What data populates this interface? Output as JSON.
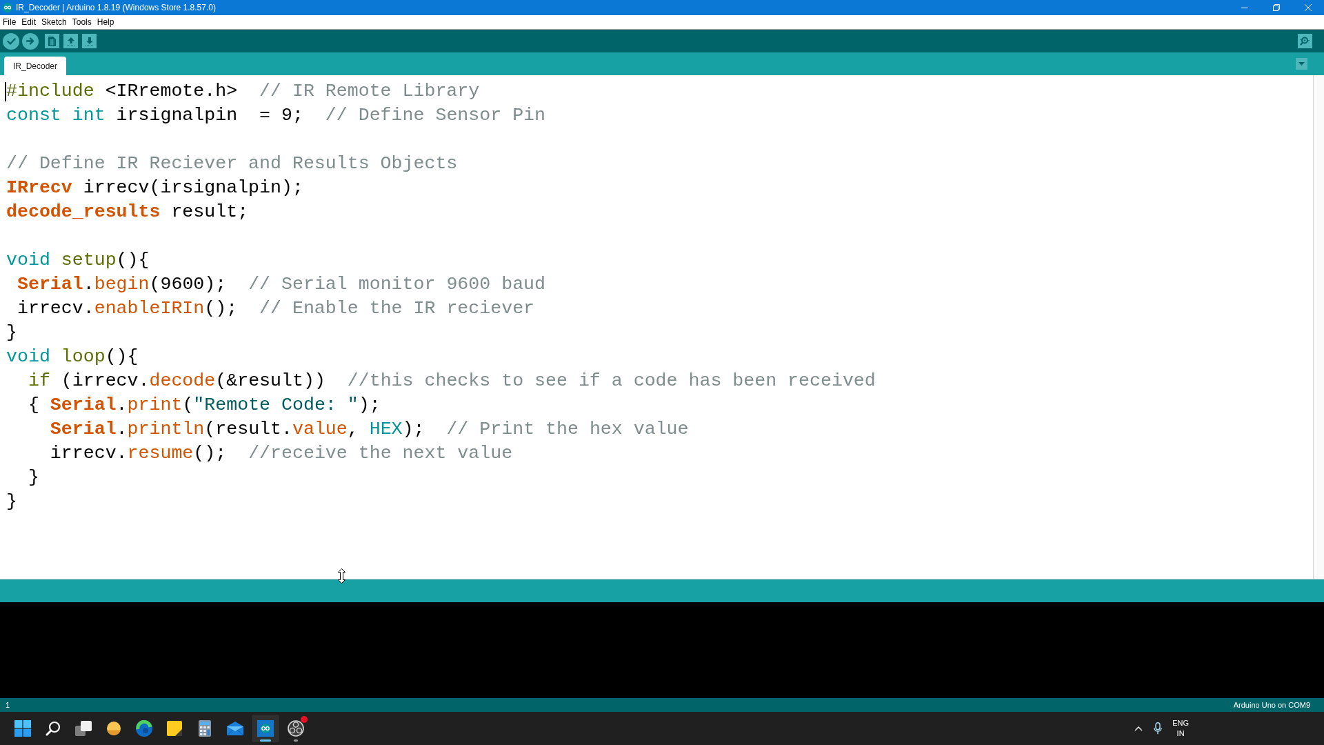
{
  "window": {
    "title": "IR_Decoder | Arduino 1.8.19 (Windows Store 1.8.57.0)"
  },
  "menu": [
    "File",
    "Edit",
    "Sketch",
    "Tools",
    "Help"
  ],
  "tabs": [
    {
      "label": "IR_Decoder",
      "selected": true
    }
  ],
  "editor": {
    "caret": true,
    "lines": [
      {
        "kind": "code",
        "tokens": [
          {
            "kind": "structure",
            "text": "#include"
          },
          {
            "kind": "plain",
            "text": " <IRremote.h>  "
          },
          {
            "kind": "comment",
            "text": "// IR Remote Library"
          }
        ]
      },
      {
        "kind": "code",
        "tokens": [
          {
            "kind": "keyword",
            "text": "const"
          },
          {
            "kind": "keyword",
            "text": " int"
          },
          {
            "kind": "plain",
            "text": " irsignalpin  = 9;  "
          },
          {
            "kind": "comment",
            "text": "// Define Sensor Pin"
          }
        ]
      },
      {
        "kind": "blank"
      },
      {
        "kind": "code",
        "tokens": [
          {
            "kind": "comment",
            "text": "// Define IR Reciever and Results Objects"
          }
        ]
      },
      {
        "kind": "code",
        "tokens": [
          {
            "kind": "type",
            "text": "IRrecv"
          },
          {
            "kind": "plain",
            "text": " irrecv(irsignalpin);"
          }
        ]
      },
      {
        "kind": "code",
        "tokens": [
          {
            "kind": "type",
            "text": "decode_results"
          },
          {
            "kind": "plain",
            "text": " result;"
          }
        ]
      },
      {
        "kind": "blank"
      },
      {
        "kind": "code",
        "tokens": [
          {
            "kind": "keyword",
            "text": "void"
          },
          {
            "kind": "structure",
            "text": " setup"
          },
          {
            "kind": "plain",
            "text": "(){"
          }
        ]
      },
      {
        "kind": "code",
        "tokens": [
          {
            "kind": "type",
            "text": " Serial"
          },
          {
            "kind": "plain",
            "text": "."
          },
          {
            "kind": "method",
            "text": "begin"
          },
          {
            "kind": "plain",
            "text": "(9600);  "
          },
          {
            "kind": "comment",
            "text": "// Serial monitor 9600 baud"
          }
        ]
      },
      {
        "kind": "code",
        "tokens": [
          {
            "kind": "plain",
            "text": " irrecv."
          },
          {
            "kind": "method",
            "text": "enableIRIn"
          },
          {
            "kind": "plain",
            "text": "();  "
          },
          {
            "kind": "comment",
            "text": "// Enable the IR reciever"
          }
        ]
      },
      {
        "kind": "code",
        "tokens": [
          {
            "kind": "plain",
            "text": "}"
          }
        ]
      },
      {
        "kind": "code",
        "tokens": [
          {
            "kind": "keyword",
            "text": "void"
          },
          {
            "kind": "structure",
            "text": " loop"
          },
          {
            "kind": "plain",
            "text": "(){"
          }
        ]
      },
      {
        "kind": "code",
        "tokens": [
          {
            "kind": "structure",
            "text": "  if"
          },
          {
            "kind": "plain",
            "text": " (irrecv."
          },
          {
            "kind": "method",
            "text": "decode"
          },
          {
            "kind": "plain",
            "text": "(&result))  "
          },
          {
            "kind": "comment",
            "text": "//this checks to see if a code has been received"
          }
        ]
      },
      {
        "kind": "code",
        "tokens": [
          {
            "kind": "plain",
            "text": "  { "
          },
          {
            "kind": "type",
            "text": "Serial"
          },
          {
            "kind": "plain",
            "text": "."
          },
          {
            "kind": "method",
            "text": "print"
          },
          {
            "kind": "plain",
            "text": "("
          },
          {
            "kind": "string",
            "text": "\"Remote Code: \""
          },
          {
            "kind": "plain",
            "text": ");"
          }
        ]
      },
      {
        "kind": "code",
        "tokens": [
          {
            "kind": "type",
            "text": "    Serial"
          },
          {
            "kind": "plain",
            "text": "."
          },
          {
            "kind": "method",
            "text": "println"
          },
          {
            "kind": "plain",
            "text": "(result."
          },
          {
            "kind": "method",
            "text": "value"
          },
          {
            "kind": "plain",
            "text": ", "
          },
          {
            "kind": "literal",
            "text": "HEX"
          },
          {
            "kind": "plain",
            "text": ");  "
          },
          {
            "kind": "comment",
            "text": "// Print the hex value"
          }
        ]
      },
      {
        "kind": "code",
        "tokens": [
          {
            "kind": "plain",
            "text": "    irrecv."
          },
          {
            "kind": "method",
            "text": "resume"
          },
          {
            "kind": "plain",
            "text": "();  "
          },
          {
            "kind": "comment",
            "text": "//receive the next value"
          }
        ]
      },
      {
        "kind": "code",
        "tokens": [
          {
            "kind": "plain",
            "text": "  }"
          }
        ]
      },
      {
        "kind": "code",
        "tokens": [
          {
            "kind": "plain",
            "text": "}"
          }
        ]
      }
    ]
  },
  "status_bar": {
    "line": "1",
    "board": "Arduino Uno on COM9"
  },
  "taskbar": {
    "apps": [
      {
        "kind": "start",
        "selected": false,
        "running": false,
        "badge": false
      },
      {
        "kind": "search",
        "selected": false,
        "running": false,
        "badge": false
      },
      {
        "kind": "taskview",
        "selected": false,
        "running": false,
        "badge": false
      },
      {
        "kind": "orb",
        "selected": false,
        "running": false,
        "badge": false
      },
      {
        "kind": "swirl",
        "selected": false,
        "running": false,
        "badge": false
      },
      {
        "kind": "note",
        "selected": false,
        "running": false,
        "badge": false
      },
      {
        "kind": "calculator",
        "selected": false,
        "running": false,
        "badge": false
      },
      {
        "kind": "mail",
        "selected": false,
        "running": false,
        "badge": false
      },
      {
        "kind": "infinity",
        "selected": true,
        "running": true,
        "badge": false
      },
      {
        "kind": "aperture",
        "selected": false,
        "running": true,
        "badge": true
      }
    ],
    "tray": {
      "language": "ENG",
      "region": "IN"
    }
  }
}
